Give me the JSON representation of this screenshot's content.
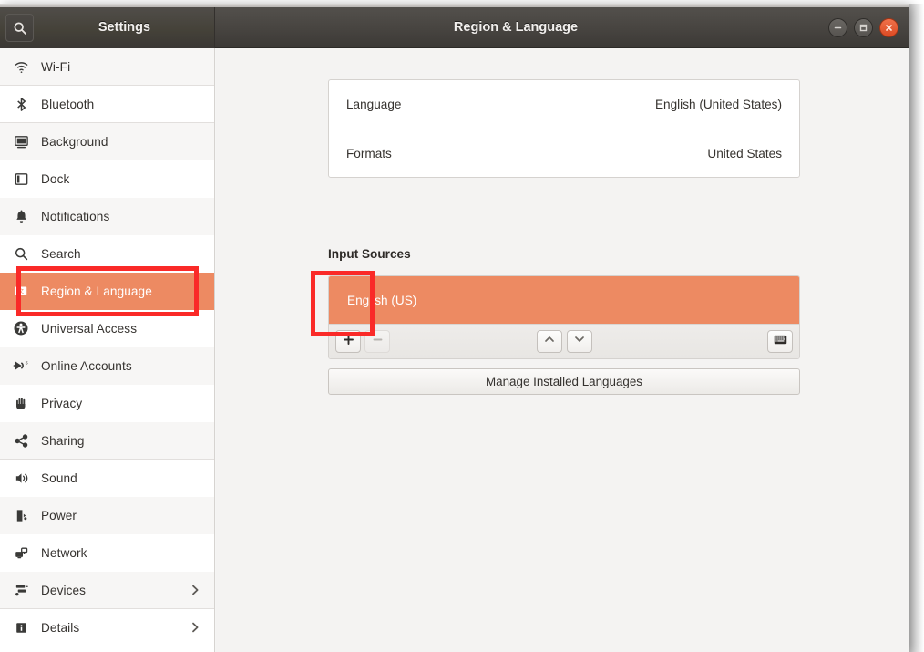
{
  "window": {
    "app_title": "Settings",
    "title": "Region & Language",
    "search_icon": "search-icon",
    "buttons": {
      "minimize": "minimize-button",
      "maximize": "maximize-button",
      "close": "close-button"
    }
  },
  "sidebar": {
    "items": [
      {
        "label": "Wi-Fi",
        "icon": "wifi-icon",
        "selected": false,
        "chevron": false
      },
      {
        "label": "Bluetooth",
        "icon": "bluetooth-icon",
        "selected": false,
        "chevron": false
      },
      {
        "label": "Background",
        "icon": "background-icon",
        "selected": false,
        "chevron": false
      },
      {
        "label": "Dock",
        "icon": "dock-icon",
        "selected": false,
        "chevron": false
      },
      {
        "label": "Notifications",
        "icon": "bell-icon",
        "selected": false,
        "chevron": false
      },
      {
        "label": "Search",
        "icon": "search-icon",
        "selected": false,
        "chevron": false
      },
      {
        "label": "Region & Language",
        "icon": "region-language-icon",
        "selected": true,
        "chevron": false
      },
      {
        "label": "Universal Access",
        "icon": "accessibility-icon",
        "selected": false,
        "chevron": false
      },
      {
        "label": "Online Accounts",
        "icon": "online-accounts-icon",
        "selected": false,
        "chevron": false
      },
      {
        "label": "Privacy",
        "icon": "hand-icon",
        "selected": false,
        "chevron": false
      },
      {
        "label": "Sharing",
        "icon": "share-icon",
        "selected": false,
        "chevron": false
      },
      {
        "label": "Sound",
        "icon": "speaker-icon",
        "selected": false,
        "chevron": false
      },
      {
        "label": "Power",
        "icon": "battery-icon",
        "selected": false,
        "chevron": false
      },
      {
        "label": "Network",
        "icon": "network-icon",
        "selected": false,
        "chevron": false
      },
      {
        "label": "Devices",
        "icon": "devices-icon",
        "selected": false,
        "chevron": true
      },
      {
        "label": "Details",
        "icon": "info-icon",
        "selected": false,
        "chevron": true
      }
    ]
  },
  "main": {
    "rows": [
      {
        "label": "Language",
        "value": "English (United States)"
      },
      {
        "label": "Formats",
        "value": "United States"
      }
    ],
    "input_sources": {
      "heading": "Input Sources",
      "items": [
        {
          "label": "English (US)",
          "selected": true
        }
      ],
      "toolbar": {
        "add": "+",
        "remove": "−",
        "move_up": "chevron-up-icon",
        "move_down": "chevron-down-icon",
        "keyboard_preview": "keyboard-icon"
      }
    },
    "manage_button": "Manage Installed Languages"
  },
  "annotations": [
    {
      "name": "highlight-region-language-sidebar",
      "color": "#FA2A28"
    },
    {
      "name": "highlight-add-input-source-button",
      "color": "#FA2A28"
    }
  ],
  "colors": {
    "accent_orange": "#ED8A62",
    "annotation_red": "#FA2A28",
    "titlebar_dark": "#474440",
    "content_bg": "#F4F3F2"
  }
}
